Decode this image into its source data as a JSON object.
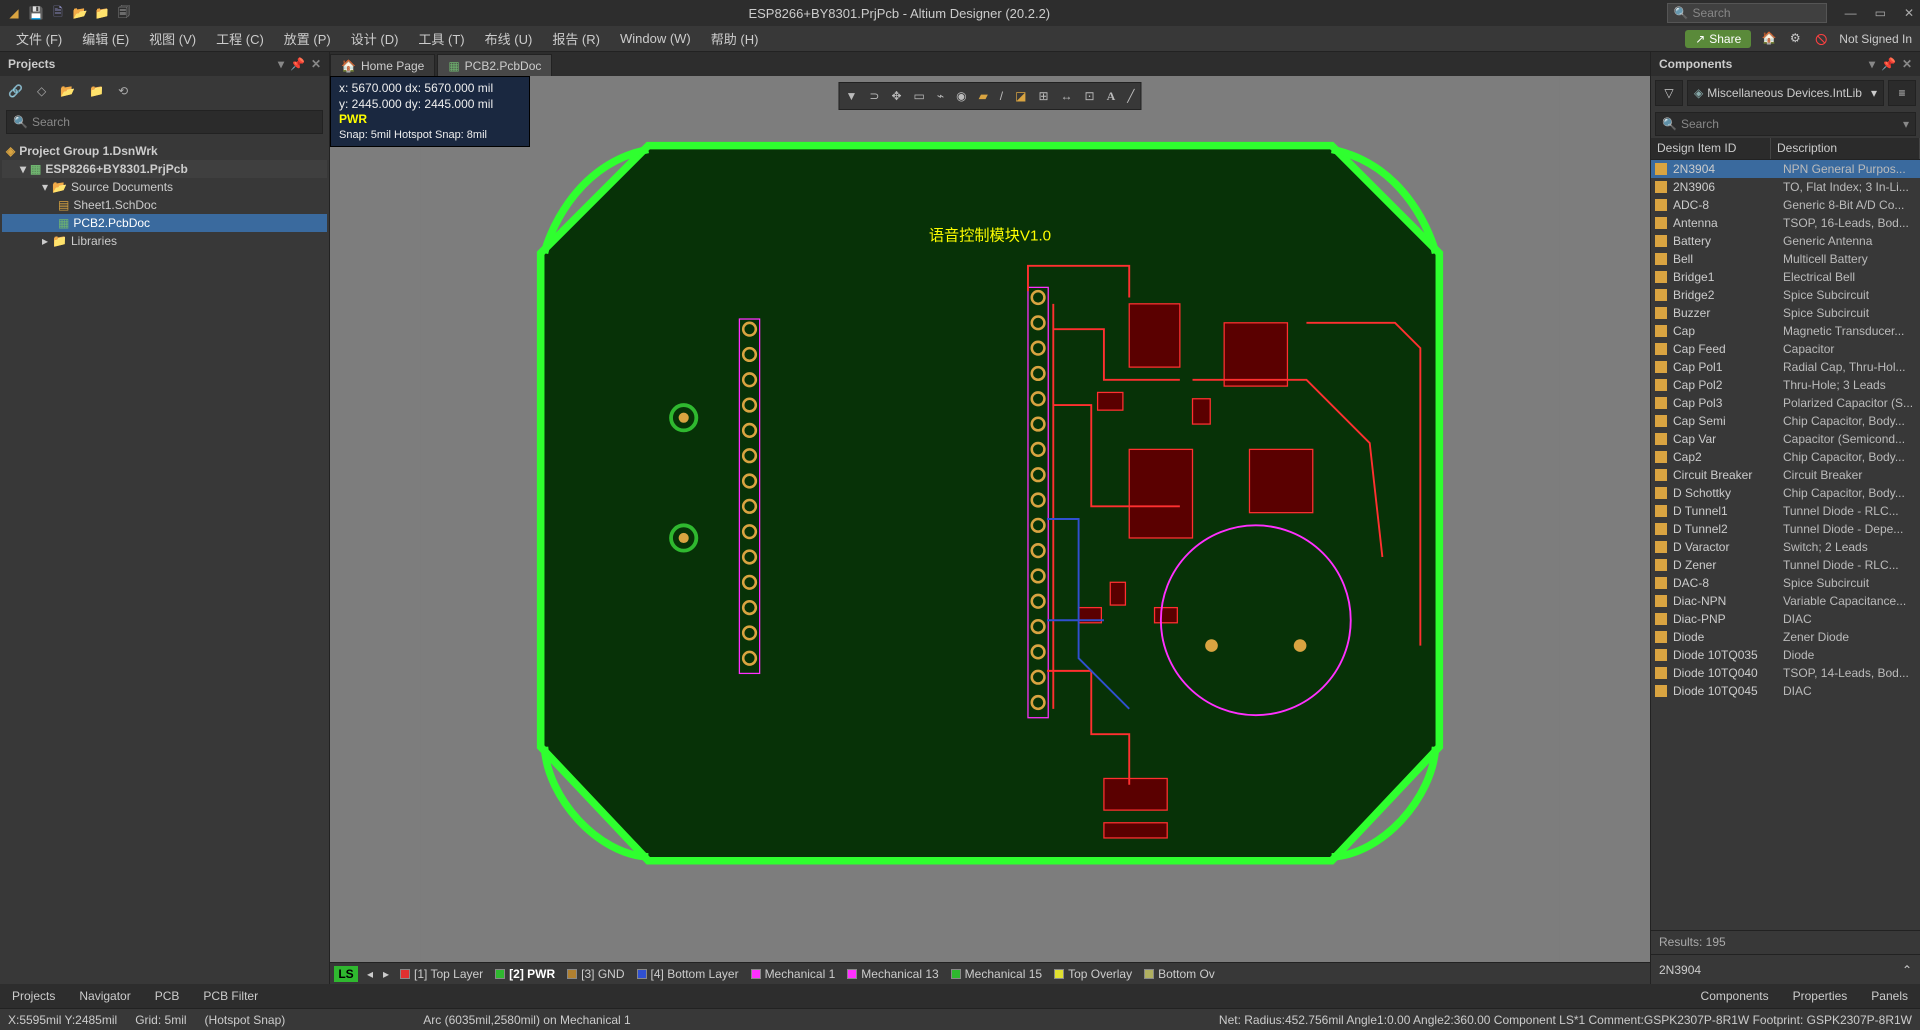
{
  "title": "ESP8266+BY8301.PrjPcb - Altium Designer (20.2.2)",
  "titlebar_search_placeholder": "Search",
  "menubar": [
    "文件 (F)",
    "编辑 (E)",
    "视图 (V)",
    "工程 (C)",
    "放置 (P)",
    "设计 (D)",
    "工具 (T)",
    "布线 (U)",
    "报告 (R)",
    "Window (W)",
    "帮助 (H)"
  ],
  "share_label": "Share",
  "not_signed_in": "Not Signed In",
  "projects_panel_title": "Projects",
  "search_placeholder": "Search",
  "tree": {
    "group": "Project Group 1.DsnWrk",
    "project": "ESP8266+BY8301.PrjPcb",
    "source_docs": "Source Documents",
    "sch": "Sheet1.SchDoc",
    "pcb": "PCB2.PcbDoc",
    "libs": "Libraries"
  },
  "doc_tabs": {
    "home": "Home Page",
    "pcb": "PCB2.PcbDoc"
  },
  "coords": {
    "l1": "x:  5670.000   dx:  5670.000 mil",
    "l2": "y:  2445.000   dy:  2445.000 mil",
    "net": "PWR",
    "snap": "Snap: 5mil Hotspot Snap: 8mil"
  },
  "pcb_title_text": "语音控制模块V1.0",
  "layers": [
    "LS",
    "[1] Top Layer",
    "[2] PWR",
    "[3] GND",
    "[4] Bottom Layer",
    "Mechanical 1",
    "Mechanical 13",
    "Mechanical 15",
    "Top Overlay",
    "Bottom Ov"
  ],
  "layer_colors": [
    "#2fb82f",
    "#e03030",
    "#2fb82f",
    "#b08030",
    "#3050d0",
    "#ff30ff",
    "#ff30ff",
    "#2fb82f",
    "#e0e030",
    "#b0b060"
  ],
  "layer_active_idx": 2,
  "components_panel_title": "Components",
  "lib_name": "Miscellaneous Devices.IntLib",
  "comp_search_placeholder": "Search",
  "col_name": "Design Item ID",
  "col_desc": "Description",
  "components": [
    {
      "n": "2N3904",
      "d": "NPN General Purpos..."
    },
    {
      "n": "2N3906",
      "d": "TO, Flat Index; 3 In-Li..."
    },
    {
      "n": "ADC-8",
      "d": "Generic 8-Bit A/D Co..."
    },
    {
      "n": "Antenna",
      "d": "TSOP, 16-Leads, Bod..."
    },
    {
      "n": "Battery",
      "d": "Generic Antenna"
    },
    {
      "n": "Bell",
      "d": "Multicell Battery"
    },
    {
      "n": "Bridge1",
      "d": "Electrical Bell"
    },
    {
      "n": "Bridge2",
      "d": "Spice Subcircuit"
    },
    {
      "n": "Buzzer",
      "d": "Spice Subcircuit"
    },
    {
      "n": "Cap",
      "d": "Magnetic Transducer..."
    },
    {
      "n": "Cap Feed",
      "d": "Capacitor"
    },
    {
      "n": "Cap Pol1",
      "d": "Radial Cap, Thru-Hol..."
    },
    {
      "n": "Cap Pol2",
      "d": "Thru-Hole; 3 Leads"
    },
    {
      "n": "Cap Pol3",
      "d": "Polarized Capacitor (S..."
    },
    {
      "n": "Cap Semi",
      "d": "Chip Capacitor, Body..."
    },
    {
      "n": "Cap Var",
      "d": "Capacitor (Semicond..."
    },
    {
      "n": "Cap2",
      "d": "Chip Capacitor, Body..."
    },
    {
      "n": "Circuit Breaker",
      "d": "Circuit Breaker"
    },
    {
      "n": "D Schottky",
      "d": "Chip Capacitor, Body..."
    },
    {
      "n": "D Tunnel1",
      "d": "Tunnel Diode - RLC..."
    },
    {
      "n": "D Tunnel2",
      "d": "Tunnel Diode - Depe..."
    },
    {
      "n": "D Varactor",
      "d": "Switch; 2 Leads"
    },
    {
      "n": "D Zener",
      "d": "Tunnel Diode - RLC..."
    },
    {
      "n": "DAC-8",
      "d": "Spice Subcircuit"
    },
    {
      "n": "Diac-NPN",
      "d": "Variable Capacitance..."
    },
    {
      "n": "Diac-PNP",
      "d": "DIAC"
    },
    {
      "n": "Diode",
      "d": "Zener Diode"
    },
    {
      "n": "Diode 10TQ035",
      "d": "Diode"
    },
    {
      "n": "Diode 10TQ040",
      "d": "TSOP, 14-Leads, Bod..."
    },
    {
      "n": "Diode 10TQ045",
      "d": "DIAC"
    }
  ],
  "selected_component": 0,
  "results_text": "Results: 195",
  "preview_component": "2N3904",
  "bottom_tabs_left": [
    "Projects",
    "Navigator",
    "PCB",
    "PCB Filter"
  ],
  "bottom_tabs_right": [
    "Components",
    "Properties"
  ],
  "panels_label": "Panels",
  "status": {
    "xy": "X:5595mil Y:2485mil",
    "grid": "Grid: 5mil",
    "hotspot": "(Hotspot Snap)",
    "obj": "Arc (6035mil,2580mil) on Mechanical 1",
    "right": "Net:   Radius:452.756mil Angle1:0.00 Angle2:360.00   Component LS*1 Comment:GSPK2307P-8R1W Footprint: GSPK2307P-8R1W"
  }
}
